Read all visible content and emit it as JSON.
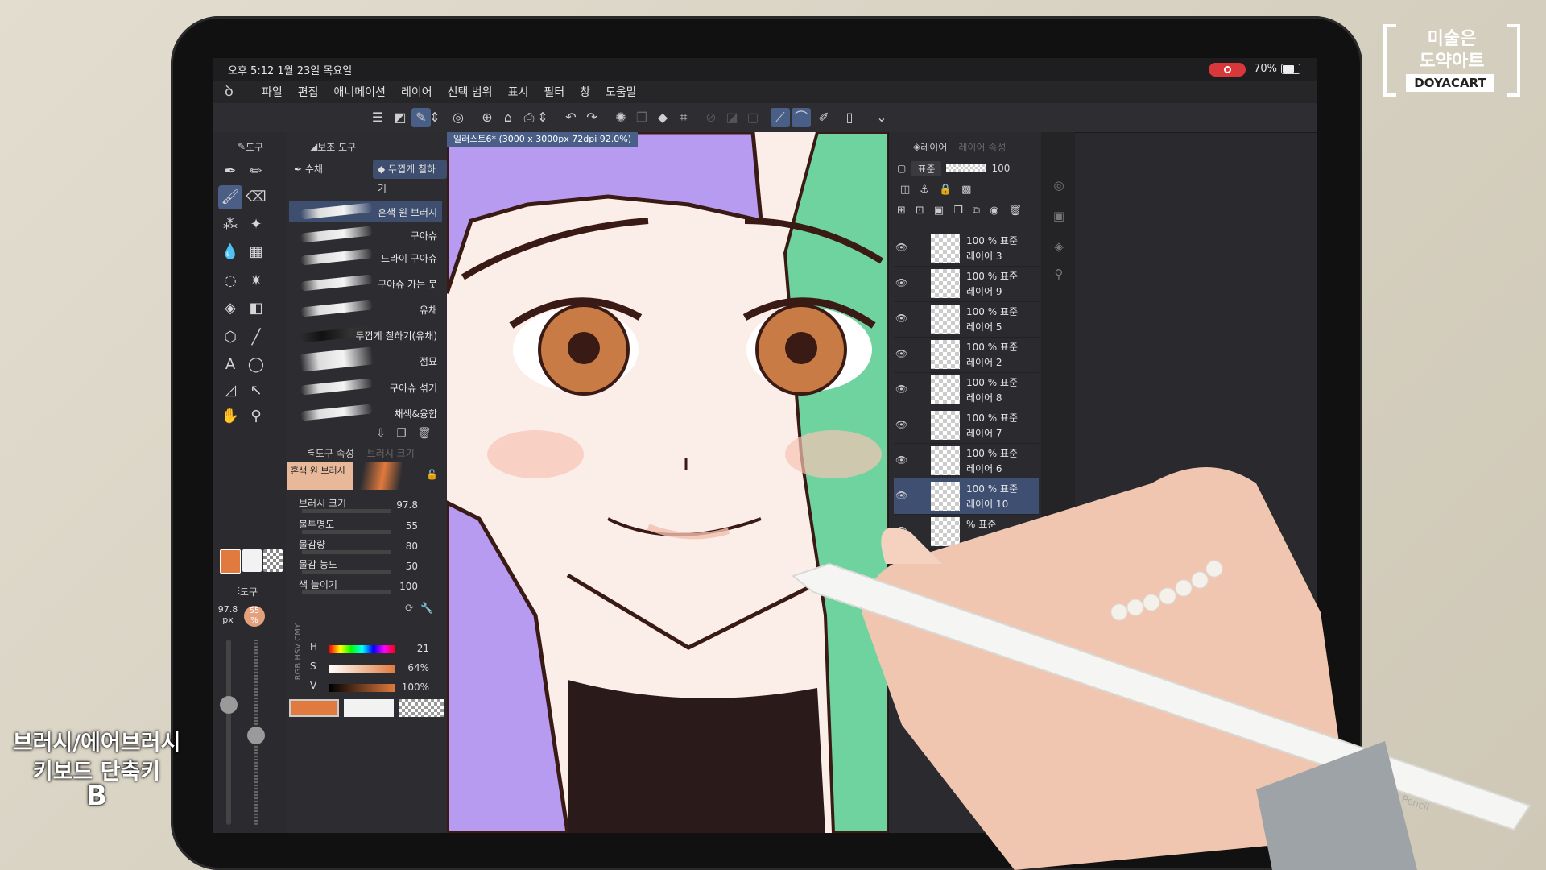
{
  "statusbar": {
    "time": "오후 5:12  1월 23일 목요일",
    "battery": "70%"
  },
  "menu": [
    "파일",
    "편집",
    "애니메이션",
    "레이어",
    "선택 범위",
    "표시",
    "필터",
    "창",
    "도움말"
  ],
  "tool_panel": {
    "tab": "도구"
  },
  "sub_tool_panel": {
    "tab": "보조 도구",
    "group_a": "수채",
    "group_b": "두껍게 칠하기"
  },
  "brushes": [
    "혼색 원 브러시",
    "구아슈",
    "드라이 구아슈",
    "구아슈 가는 붓",
    "유채",
    "두껍게 칠하기(유채)",
    "점묘",
    "구아슈 섞기",
    "채색&융합"
  ],
  "tool_property": {
    "tab": "도구 속성",
    "tab2": "브러시 크기",
    "brush": "혼색 원 브러시",
    "rows": [
      {
        "label": "브러시 크기",
        "value": "97.8"
      },
      {
        "label": "불투명도",
        "value": "55"
      },
      {
        "label": "물감량",
        "value": "80"
      },
      {
        "label": "물감 농도",
        "value": "50"
      },
      {
        "label": "색 늘이기",
        "value": "100"
      }
    ]
  },
  "quick": {
    "tab": "도구",
    "size": "97.8",
    "size_unit": "px",
    "opacity": "55",
    "opacity_unit": "%"
  },
  "color": {
    "mode_labels": [
      "RGB",
      "HSV",
      "CMY"
    ],
    "rows": [
      {
        "label": "H",
        "value": "21"
      },
      {
        "label": "S",
        "value": "64%"
      },
      {
        "label": "V",
        "value": "100%"
      }
    ],
    "main": "#e07a3e",
    "sub": "#f2f2f2"
  },
  "canvas": {
    "doc_title": "일러스트6* (3000 x 3000px 72dpi 92.0%)"
  },
  "layer_panel": {
    "tab": "레이어",
    "tab2": "레이어 속성",
    "blend": "표준",
    "opacity": "100",
    "layers": [
      {
        "mode": "100 % 표준",
        "name": "레이어 3"
      },
      {
        "mode": "100 % 표준",
        "name": "레이어 9"
      },
      {
        "mode": "100 % 표준",
        "name": "레이어 5"
      },
      {
        "mode": "100 % 표준",
        "name": "레이어 2"
      },
      {
        "mode": "100 % 표준",
        "name": "레이어 8"
      },
      {
        "mode": "100 % 표준",
        "name": "레이어 7"
      },
      {
        "mode": "100 % 표준",
        "name": "레이어 6"
      },
      {
        "mode": "100 % 표준",
        "name": "레이어 10"
      },
      {
        "mode": "% 표준",
        "name": ""
      }
    ]
  },
  "overlay": {
    "logo_line1": "미술은",
    "logo_line2": "도약아트",
    "logo_en": "DOYACART",
    "caption_line1": "브러시/에어브러시",
    "caption_line2": "키보드 단축키",
    "caption_key": "B",
    "pencil_brand": "Pencil"
  }
}
